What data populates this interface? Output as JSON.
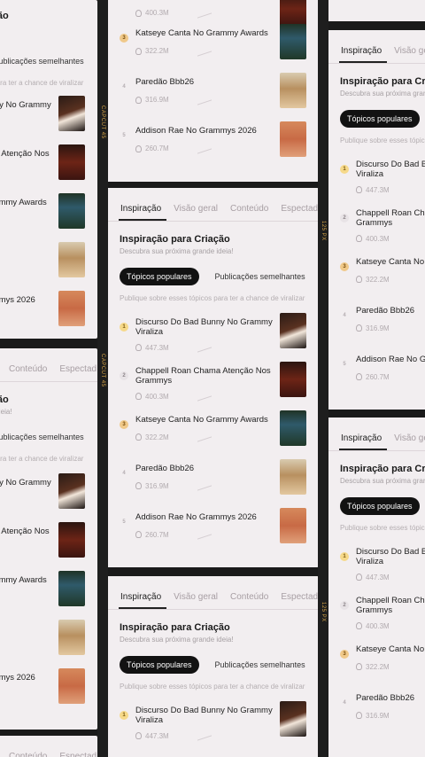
{
  "tabs": [
    "Inspiração",
    "Visão geral",
    "Conteúdo",
    "Espectad"
  ],
  "section": {
    "title": "Inspiração para Criação",
    "subtitle": "Descubra sua próxima grande ideia!"
  },
  "pills": {
    "active": "Tópicos populares",
    "inactive": "Publicações semelhantes"
  },
  "hint": "Publique sobre esses tópicos para ter a chance de viralizar",
  "items": [
    {
      "rank": "1",
      "title": "Discurso Do Bad Bunny No Grammy Viraliza",
      "views": "447.3M"
    },
    {
      "rank": "2",
      "title": "Chappell Roan Chama Atenção Nos Grammys",
      "views": "400.3M"
    },
    {
      "rank": "3",
      "title": "Katseye Canta No Grammy Awards",
      "views": "322.2M"
    },
    {
      "rank": "4",
      "title": "Paredão Bbb26",
      "views": "316.9M"
    },
    {
      "rank": "5",
      "title": "Addison Rae No Grammys 2026",
      "views": "260.7M"
    }
  ],
  "strip": {
    "a": "CAPCUT 45",
    "b": "125 PX"
  },
  "colors": {
    "card_bg": "#f2eef0",
    "pill_active": "#121212",
    "strip": "#d8a548"
  }
}
